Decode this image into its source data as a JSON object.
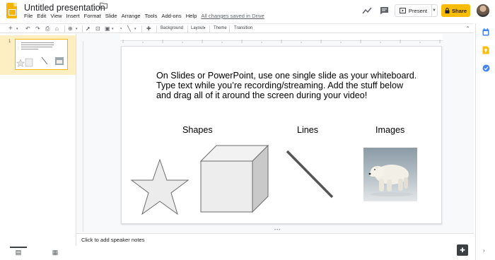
{
  "header": {
    "title": "Untitled presentation",
    "menus": [
      "File",
      "Edit",
      "View",
      "Insert",
      "Format",
      "Slide",
      "Arrange",
      "Tools",
      "Add-ons",
      "Help"
    ],
    "saved_message": "All changes saved in Drive",
    "present_label": "Present",
    "share_label": "Share",
    "brand_color": "#fbbc04"
  },
  "toolbar": {
    "background_label": "Background",
    "layout_label": "Layout",
    "theme_label": "Theme",
    "transition_label": "Transition"
  },
  "filmstrip": {
    "slide_number": "1"
  },
  "slide": {
    "body_text": "On Slides or PowerPoint, use one single slide as your whiteboard. Type text while you’re recording/streaming. Add the stuff below and drag all of it around the screen during your video!",
    "label_shapes": "Shapes",
    "label_lines": "Lines",
    "label_images": "Images"
  },
  "notes": {
    "placeholder": "Click to add speaker notes"
  }
}
